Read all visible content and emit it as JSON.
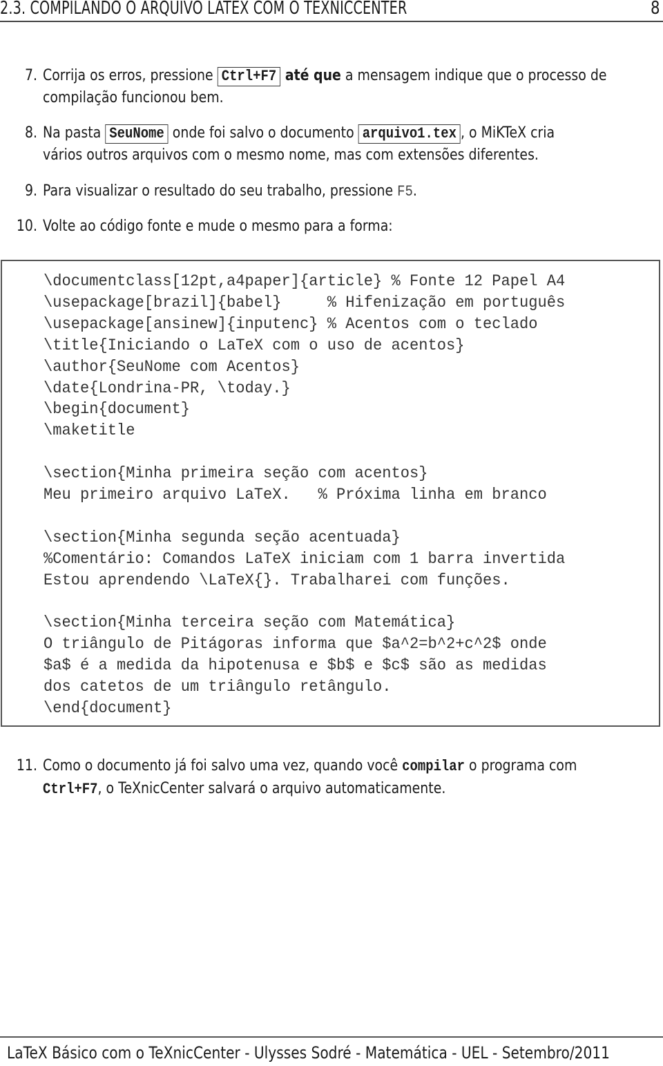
{
  "header": {
    "title": "2.3.  COMPILANDO O ARQUIVO LATEX COM O TEXNICCENTER",
    "page_number": "8"
  },
  "steps": [
    {
      "number": "7.",
      "line1": {
        "before": "Corrija os erros, pressione ",
        "key": "Ctrl+F7",
        "bold": " até que",
        "after": " a mensagem indique que o processo de"
      },
      "line2": "compilação funcionou bem."
    },
    {
      "number": "8.",
      "line1": {
        "before": "Na pasta ",
        "folder": "SeuNome",
        "middle": " onde foi salvo o documento ",
        "file": "arquivo1.tex",
        "after": ", o MiKTeX cria"
      },
      "line2": "vários outros arquivos com o mesmo nome, mas com extensões diferentes."
    },
    {
      "number": "9.",
      "line1": {
        "before": "Para visualizar o resultado do seu trabalho, pressione ",
        "key": "F5",
        "after": "."
      }
    },
    {
      "number": "10.",
      "line1": {
        "text": "Volte ao código fonte e mude o mesmo para a forma:"
      }
    },
    {
      "number": "11.",
      "line1": {
        "before": "Como o documento já foi salvo uma vez, quando você ",
        "bold": "compilar",
        "after": " o programa com"
      },
      "line2": {
        "key": "Ctrl+F7",
        "after": ", o TeXnicCenter salvará o arquivo automaticamente."
      }
    }
  ],
  "code_lines": [
    "\\documentclass[12pt,a4paper]{article} % Fonte 12 Papel A4",
    "\\usepackage[brazil]{babel}     % Hifenização em português",
    "\\usepackage[ansinew]{inputenc} % Acentos com o teclado",
    "\\title{Iniciando o LaTeX com o uso de acentos}",
    "\\author{SeuNome com Acentos}",
    "\\date{Londrina-PR, \\today.}",
    "\\begin{document}",
    "\\maketitle",
    "",
    "\\section{Minha primeira seção com acentos}",
    "Meu primeiro arquivo LaTeX.   % Próxima linha em branco",
    "",
    "\\section{Minha segunda seção acentuada}",
    "%Comentário: Comandos LaTeX iniciam com 1 barra invertida",
    "Estou aprendendo \\LaTeX{}. Trabalharei com funções.",
    "",
    "\\section{Minha terceira seção com Matemática}",
    "O triângulo de Pitágoras informa que $a^2=b^2+c^2$ onde",
    "$a$ é a medida da hipotenusa e $b$ e $c$ são as medidas",
    "dos catetos de um triângulo retângulo.",
    "\\end{document}"
  ],
  "footer": "LaTeX Básico com o TeXnicCenter - Ulysses Sodré - Matemática - UEL - Setembro/2011"
}
